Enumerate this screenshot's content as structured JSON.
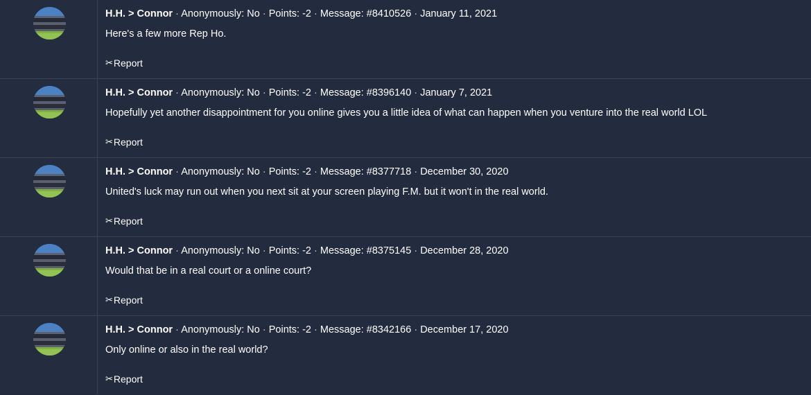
{
  "messages": [
    {
      "sender": "H.H.",
      "arrow": ">",
      "recipient": "Connor",
      "anonymously": "Anonymously: No",
      "points": "Points: -2",
      "message_id": "Message: #8410526",
      "date": "January 11, 2021",
      "text": "Here's a few more Rep Ho.",
      "report_label": "Report"
    },
    {
      "sender": "H.H.",
      "arrow": ">",
      "recipient": "Connor",
      "anonymously": "Anonymously: No",
      "points": "Points: -2",
      "message_id": "Message: #8396140",
      "date": "January 7, 2021",
      "text": "Hopefully yet another disappointment for you online gives you a little idea of what can happen when you venture into the real world LOL",
      "report_label": "Report"
    },
    {
      "sender": "H.H.",
      "arrow": ">",
      "recipient": "Connor",
      "anonymously": "Anonymously: No",
      "points": "Points: -2",
      "message_id": "Message: #8377718",
      "date": "December 30, 2020",
      "text": "United's luck may run out when you next sit at your screen playing F.M. but it won't in the real world.",
      "report_label": "Report"
    },
    {
      "sender": "H.H.",
      "arrow": ">",
      "recipient": "Connor",
      "anonymously": "Anonymously: No",
      "points": "Points: -2",
      "message_id": "Message: #8375145",
      "date": "December 28, 2020",
      "text": "Would that be in a real court or a online court?",
      "report_label": "Report"
    },
    {
      "sender": "H.H.",
      "arrow": ">",
      "recipient": "Connor",
      "anonymously": "Anonymously: No",
      "points": "Points: -2",
      "message_id": "Message: #8342166",
      "date": "December 17, 2020",
      "text": "Only online or also in the real world?",
      "report_label": "Report"
    }
  ],
  "separator": "·",
  "report_icon": "scissors-icon",
  "colors": {
    "background": "#222a3c",
    "divider": "#3a4356",
    "text": "#ffffff"
  }
}
